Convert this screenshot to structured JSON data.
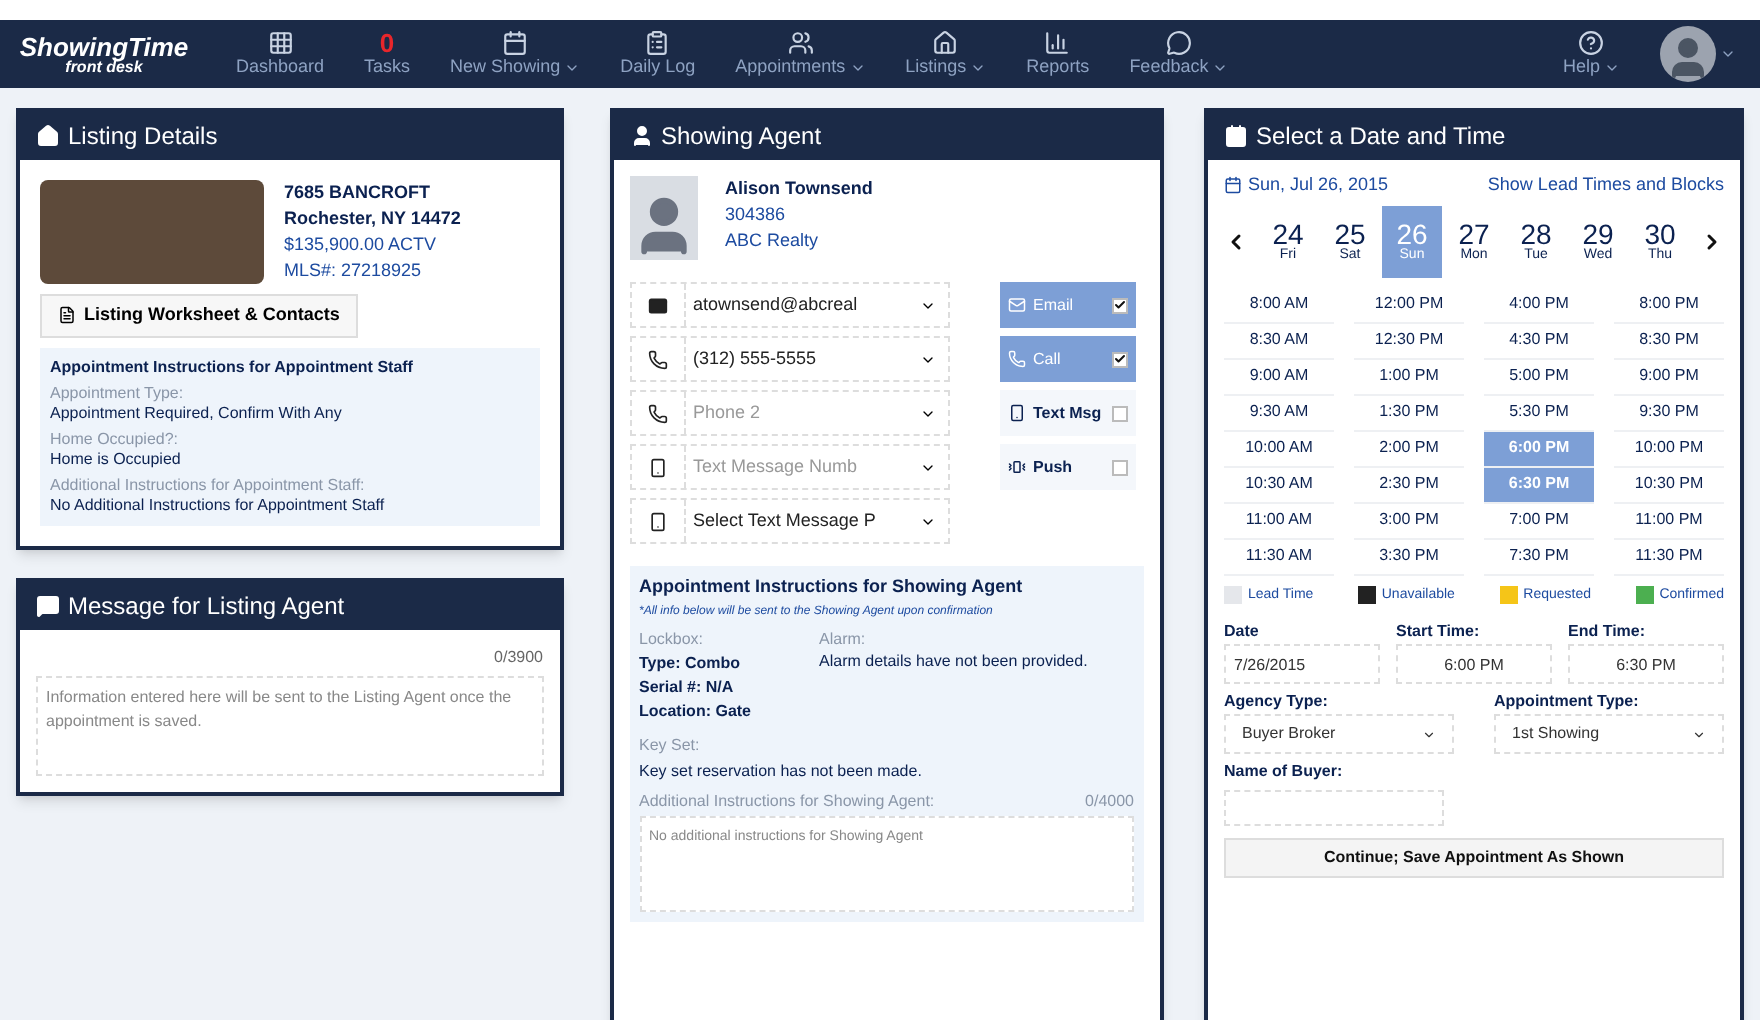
{
  "logo": {
    "title": "ShowingTime",
    "subtitle": "front desk"
  },
  "nav": [
    {
      "kind": "grid",
      "label": "Dashboard",
      "dropdown": false
    },
    {
      "kind": "count",
      "count": "0",
      "label": "Tasks",
      "dropdown": false
    },
    {
      "kind": "calendar",
      "label": "New Showing",
      "dropdown": true
    },
    {
      "kind": "clipboard",
      "label": "Daily Log",
      "dropdown": false
    },
    {
      "kind": "people",
      "label": "Appointments",
      "dropdown": true
    },
    {
      "kind": "house",
      "label": "Listings",
      "dropdown": true
    },
    {
      "kind": "bars",
      "label": "Reports",
      "dropdown": false
    },
    {
      "kind": "bubble",
      "label": "Feedback",
      "dropdown": true
    }
  ],
  "help": {
    "label": "Help",
    "dropdown": true
  },
  "listing": {
    "title": "Listing Details",
    "address": "7685 BANCROFT",
    "city": "Rochester, NY 14472",
    "price": "$135,900.00 ACTV",
    "mls": "MLS#: 27218925",
    "button": "Listing Worksheet & Contacts",
    "instructions_title": "Appointment Instructions for Appointment Staff",
    "fields": [
      {
        "label": "Appointment Type:",
        "value": "Appointment Required, Confirm With Any"
      },
      {
        "label": "Home Occupied?:",
        "value": "Home is Occupied"
      },
      {
        "label": "Additional Instructions for Appointment Staff:",
        "value": "No Additional Instructions for Appointment Staff"
      }
    ]
  },
  "message": {
    "title": "Message for Listing Agent",
    "counter": "0/3900",
    "placeholder": "Information entered here will be sent to the Listing Agent once the appointment is saved."
  },
  "agent": {
    "title": "Showing Agent",
    "name": "Alison Townsend",
    "id": "304386",
    "company": "ABC Realty",
    "contacts": [
      {
        "kind": "email",
        "value": "atownsend@abcreal"
      },
      {
        "kind": "phone",
        "value": "(312) 555-5555"
      },
      {
        "kind": "phone",
        "placeholder": "Phone 2"
      },
      {
        "kind": "mobile",
        "placeholder": "Text Message Numb"
      },
      {
        "kind": "mobile",
        "value": "Select Text Message P"
      }
    ],
    "notify": [
      {
        "kind": "email",
        "label": "Email",
        "checked": true
      },
      {
        "kind": "phone",
        "label": "Call",
        "checked": true
      },
      {
        "kind": "mobile",
        "label": "Text Msg",
        "checked": false
      },
      {
        "kind": "push",
        "label": "Push",
        "checked": false
      }
    ],
    "instructions_title": "Appointment Instructions for Showing Agent",
    "note": "*All info below will be sent to the Showing Agent upon confirmation",
    "lockbox_label": "Lockbox:",
    "lockbox": [
      "Type: Combo",
      "Serial #: N/A",
      "Location: Gate"
    ],
    "alarm_label": "Alarm:",
    "alarm": "Alarm details have not been provided.",
    "keyset_label": "Key Set:",
    "keyset": "Key set reservation has not been made.",
    "additional_label": "Additional Instructions for Showing Agent:",
    "additional_counter": "0/4000",
    "additional_placeholder": "No additional instructions for Showing Agent"
  },
  "schedule": {
    "title": "Select a Date and Time",
    "date": "Sun, Jul 26, 2015",
    "show_link": "Show Lead Times and Blocks",
    "days": [
      {
        "num": "24",
        "day": "Fri",
        "selected": false
      },
      {
        "num": "25",
        "day": "Sat",
        "selected": false
      },
      {
        "num": "26",
        "day": "Sun",
        "selected": true
      },
      {
        "num": "27",
        "day": "Mon",
        "selected": false
      },
      {
        "num": "28",
        "day": "Tue",
        "selected": false
      },
      {
        "num": "29",
        "day": "Wed",
        "selected": false
      },
      {
        "num": "30",
        "day": "Thu",
        "selected": false
      }
    ],
    "slot_columns": [
      [
        {
          "time": "8:00 AM",
          "selected": false
        },
        {
          "time": "8:30 AM",
          "selected": false
        },
        {
          "time": "9:00 AM",
          "selected": false
        },
        {
          "time": "9:30 AM",
          "selected": false
        },
        {
          "time": "10:00 AM",
          "selected": false
        },
        {
          "time": "10:30 AM",
          "selected": false
        },
        {
          "time": "11:00 AM",
          "selected": false
        },
        {
          "time": "11:30 AM",
          "selected": false
        }
      ],
      [
        {
          "time": "12:00 PM",
          "selected": false
        },
        {
          "time": "12:30 PM",
          "selected": false
        },
        {
          "time": "1:00 PM",
          "selected": false
        },
        {
          "time": "1:30 PM",
          "selected": false
        },
        {
          "time": "2:00 PM",
          "selected": false
        },
        {
          "time": "2:30 PM",
          "selected": false
        },
        {
          "time": "3:00 PM",
          "selected": false
        },
        {
          "time": "3:30 PM",
          "selected": false
        }
      ],
      [
        {
          "time": "4:00 PM",
          "selected": false
        },
        {
          "time": "4:30 PM",
          "selected": false
        },
        {
          "time": "5:00 PM",
          "selected": false
        },
        {
          "time": "5:30 PM",
          "selected": false
        },
        {
          "time": "6:00 PM",
          "selected": true
        },
        {
          "time": "6:30 PM",
          "selected": true
        },
        {
          "time": "7:00 PM",
          "selected": false
        },
        {
          "time": "7:30 PM",
          "selected": false
        }
      ],
      [
        {
          "time": "8:00 PM",
          "selected": false
        },
        {
          "time": "8:30 PM",
          "selected": false
        },
        {
          "time": "9:00 PM",
          "selected": false
        },
        {
          "time": "9:30 PM",
          "selected": false
        },
        {
          "time": "10:00 PM",
          "selected": false
        },
        {
          "time": "10:30 PM",
          "selected": false
        },
        {
          "time": "11:00 PM",
          "selected": false
        },
        {
          "time": "11:30 PM",
          "selected": false
        }
      ]
    ],
    "legend": [
      {
        "label": "Lead Time",
        "color": "#e5e7eb"
      },
      {
        "label": "Unavailable",
        "color": "#222222"
      },
      {
        "label": "Requested",
        "color": "#f5c518"
      },
      {
        "label": "Confirmed",
        "color": "#4caf50"
      }
    ],
    "date_label": "Date",
    "date_value": "7/26/2015",
    "start_label": "Start Time:",
    "start_value": "6:00 PM",
    "end_label": "End Time:",
    "end_value": "6:30 PM",
    "agency_label": "Agency Type:",
    "agency_value": "Buyer Broker",
    "appt_label": "Appointment Type:",
    "appt_value": "1st Showing",
    "buyer_label": "Name of Buyer:",
    "submit": "Continue; Save Appointment As Shown"
  }
}
